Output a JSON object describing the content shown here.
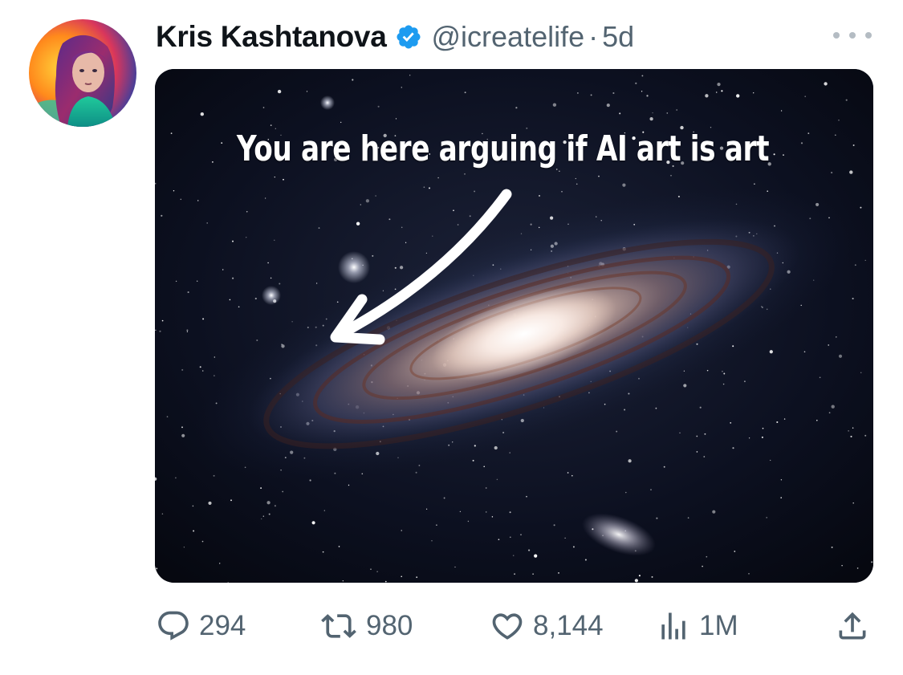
{
  "tweet": {
    "author_name": "Kris Kashtanova",
    "handle": "@icreatelife",
    "separator": "·",
    "time": "5d",
    "verified": true,
    "media_caption": "You are here arguing if AI art is art"
  },
  "metrics": {
    "replies": "294",
    "retweets": "980",
    "likes": "8,144",
    "views": "1M"
  },
  "icons": {
    "avatar": "avatar",
    "verified": "verified-badge-icon",
    "more": "more-options-icon",
    "reply": "reply-icon",
    "retweet": "retweet-icon",
    "like": "heart-icon",
    "views": "views-chart-icon",
    "share": "share-icon"
  },
  "colors": {
    "text": "#0f1419",
    "secondary": "#536471",
    "verified": "#1d9bf0"
  }
}
